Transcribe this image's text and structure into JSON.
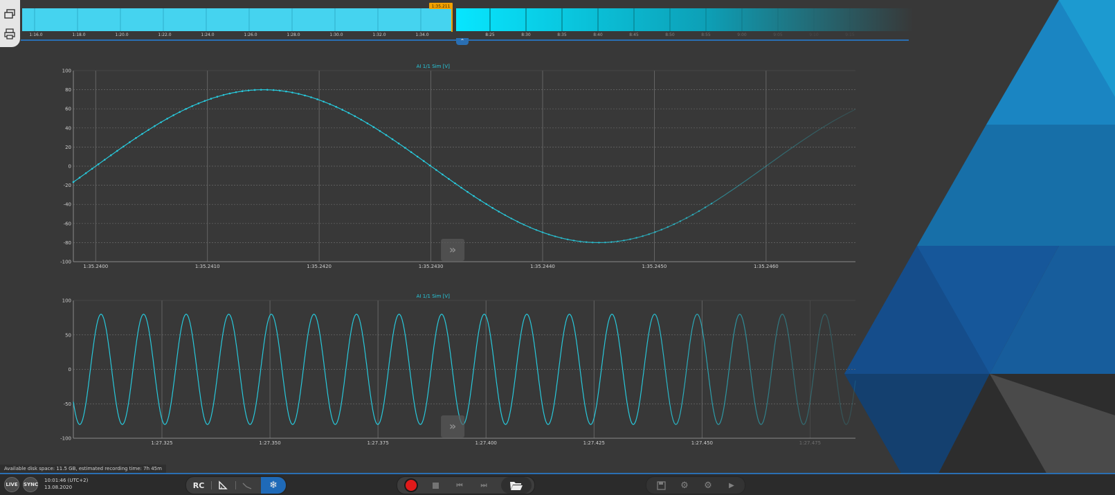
{
  "timeline": {
    "cursor_label": "1:35.211",
    "left_ticks": [
      "1:16.0",
      "1:18.0",
      "1:20.0",
      "1:22.0",
      "1:24.0",
      "1:26.0",
      "1:28.0",
      "1:30.0",
      "1:32.0",
      "1:34.0"
    ],
    "right_ticks": [
      "8:25",
      "8:30",
      "8:35",
      "8:40",
      "8:45",
      "8:50",
      "8:55",
      "9:00",
      "9:05",
      "9:10",
      "9:15"
    ]
  },
  "charts": [
    {
      "type": "line",
      "title": "AI 1/1 Sim [V]",
      "y_ticks": [
        "100",
        "80",
        "60",
        "40",
        "20",
        "0",
        "-20",
        "-40",
        "-60",
        "-80",
        "-100"
      ],
      "y_range": [
        -100,
        100
      ],
      "x_ticks": [
        "1:35.2400",
        "1:35.2410",
        "1:35.2420",
        "1:35.2430",
        "1:35.2440",
        "1:35.2450",
        "1:35.2460"
      ],
      "x_range_s": [
        95.2398,
        95.2468
      ],
      "series": {
        "amplitude": 80,
        "phase_zero_s": 95.24,
        "period_s": 0.006
      }
    },
    {
      "type": "line",
      "title": "AI 1/1 Sim [V]",
      "y_ticks": [
        "100",
        "50",
        "0",
        "-50",
        "-100"
      ],
      "y_range": [
        -100,
        100
      ],
      "x_ticks": [
        "1:27.325",
        "1:27.350",
        "1:27.375",
        "1:27.400",
        "1:27.425",
        "1:27.450",
        "1:27.475"
      ],
      "x_range_s": [
        87.3045,
        87.4855
      ],
      "series": {
        "amplitude": 80,
        "cycles_visible": 18
      }
    }
  ],
  "status": {
    "disk_text": "Available disk space: 11.5 GB, estimated recording time: 7h 45m"
  },
  "bottombar": {
    "live_label": "LIVE",
    "sync_label": "SYNC",
    "time": "10:01:46 (UTC+2)",
    "date": "13.08.2020",
    "rc_label": "RC"
  },
  "colors": {
    "signal": "#27c9dc",
    "accent": "#1f6ab8",
    "record": "#e01a1a",
    "timeline_left": "#45d3ef",
    "timeline_right": "#0ab8cf"
  }
}
